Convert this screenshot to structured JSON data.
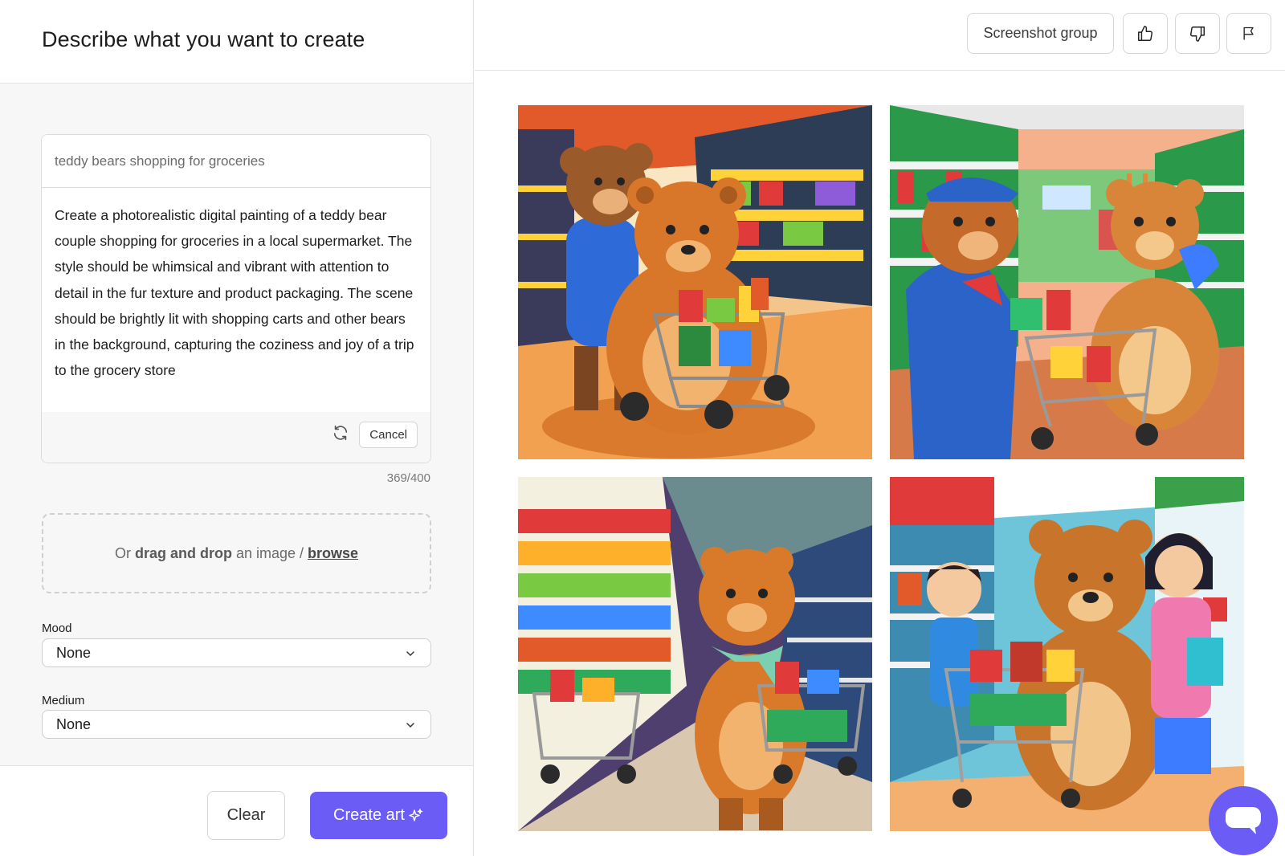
{
  "header": {
    "title": "Describe what you want to create"
  },
  "prompt": {
    "input_value": "teddy bears shopping for groceries",
    "enhanced_text": "Create a photorealistic digital painting of a teddy bear couple shopping for groceries in a local supermarket. The style should be whimsical and vibrant with attention to detail in the fur texture and product packaging. The scene should be brightly lit with shopping carts and other bears in the background, capturing the coziness and joy of a trip to the grocery store",
    "refresh_icon": "refresh-icon",
    "cancel_label": "Cancel",
    "char_count": "369/400"
  },
  "dropzone": {
    "prefix": "Or ",
    "bold": "drag and drop",
    "middle": " an image / ",
    "link": "browse"
  },
  "mood": {
    "label": "Mood",
    "value": "None"
  },
  "medium": {
    "label": "Medium",
    "value": "None"
  },
  "actions": {
    "clear_label": "Clear",
    "create_label": "Create art",
    "create_icon": "sparkle-icon"
  },
  "topbar": {
    "screenshot_group_label": "Screenshot group",
    "thumbs_up_icon": "thumbs-up-icon",
    "thumbs_down_icon": "thumbs-down-icon",
    "flag_icon": "flag-icon"
  },
  "gallery": {
    "images": [
      {
        "name": "teddy bear couple with shopping cart"
      },
      {
        "name": "bear cashier and bear with cart"
      },
      {
        "name": "bear with scarf pushing cart in aisle"
      },
      {
        "name": "bear with two children and cart"
      }
    ]
  },
  "colors": {
    "accent": "#6b5cf6"
  },
  "chat": {
    "icon": "chat-icon"
  }
}
